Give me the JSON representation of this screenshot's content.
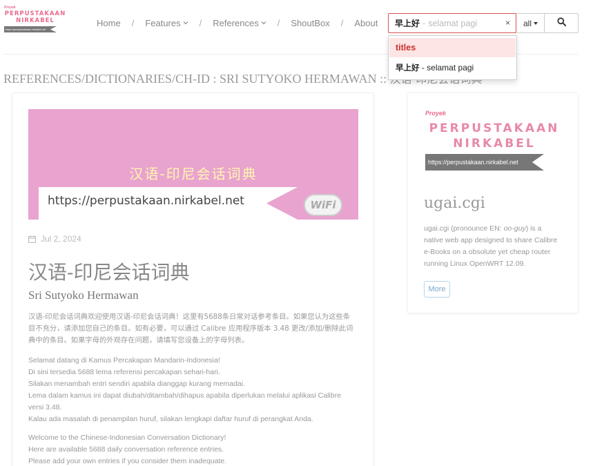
{
  "brand": {
    "small_label": "Proyek",
    "line1": "PERPUSTAKAAN",
    "line2": "NIRKABEL",
    "url": "https://perpustakaan.nirkabel.net",
    "color": "#e86b8d"
  },
  "nav": {
    "items": [
      {
        "label": "Home"
      },
      {
        "label": "Features"
      },
      {
        "label": "References"
      },
      {
        "label": "ShoutBox"
      },
      {
        "label": "About"
      }
    ],
    "separator": "/"
  },
  "search": {
    "term": "早上好",
    "separator": "-",
    "hint": "selamat pagi",
    "clear_glyph": "×",
    "scope_label": "all",
    "accent_color": "#d9534f"
  },
  "autocomplete": {
    "header": "titles",
    "items": [
      {
        "bold": "早上好",
        "rest": " - selamat pagi"
      }
    ]
  },
  "page_heading": {
    "path": "REFERENCES/DICTIONARIES/CH-ID : SRI SUTYOKO HERMAWAN :: ",
    "suffix": "汉语-印尼会话词典"
  },
  "article": {
    "cover": {
      "title": "汉语-印尼会话词典",
      "url": "https://perpustakaan.nirkabel.net",
      "badge": "WiFi",
      "background": "#e9a3cf"
    },
    "date": "Jul 2, 2024",
    "title": "汉语-印尼会话词典",
    "author": "Sri Sutyoko Hermawan",
    "para_zh": [
      "汉语-印尼会话词典欢迎使用汉语-印尼会话词典！这里有5688条日常对话参考条目。如果您认为这些条",
      "目不充分，请添加您自己的条目。如有必要，可以通过 Calibre 应用程序版本 3.48 更改/添加/删除此词",
      "典中的条目。如果字母的外观存在问题，请填写您设备上的字母列表。"
    ],
    "para_id": [
      "Selamat datang di Kamus Percakapan Mandarin-Indonesia!",
      "Di sini tersedia 5688 lema referensi percakapan sehari-hari.",
      "Silakan menambah entri sendiri apabila dianggap kurang memadai.",
      "Lema dalam kamus ini dapat diubah/ditambah/dihapus apabila diperlukan melalui aplikasi Calibre",
      "versi 3.48.",
      "Kalau ada masalah di penampilan huruf, silakan lengkapi daftar huruf di perangkat Anda."
    ],
    "para_en": [
      "Welcome to the Chinese-Indonesian Conversation Dictionary!",
      "Here are available 5688 daily conversation reference entries.",
      "Please add your own entries if you consider them inadequate."
    ]
  },
  "sidebar": {
    "logo": {
      "small_label": "Proyek",
      "line1": "PERPUSTAKAAN",
      "line2": "NIRKABEL",
      "url": "https://perpustakaan.nirkabel.net"
    },
    "title": "ugai.cgi",
    "desc_line1_pre": "ugai.cgi (pronounce EN: ",
    "desc_line1_em": "oo-guy",
    "desc_line1_post": ") is a",
    "desc_lines": [
      "native web app designed to share Calibre",
      "e-Books on a obsolute yet cheap router",
      "running Linux OpenWRT 12.09."
    ],
    "more_label": "More"
  }
}
